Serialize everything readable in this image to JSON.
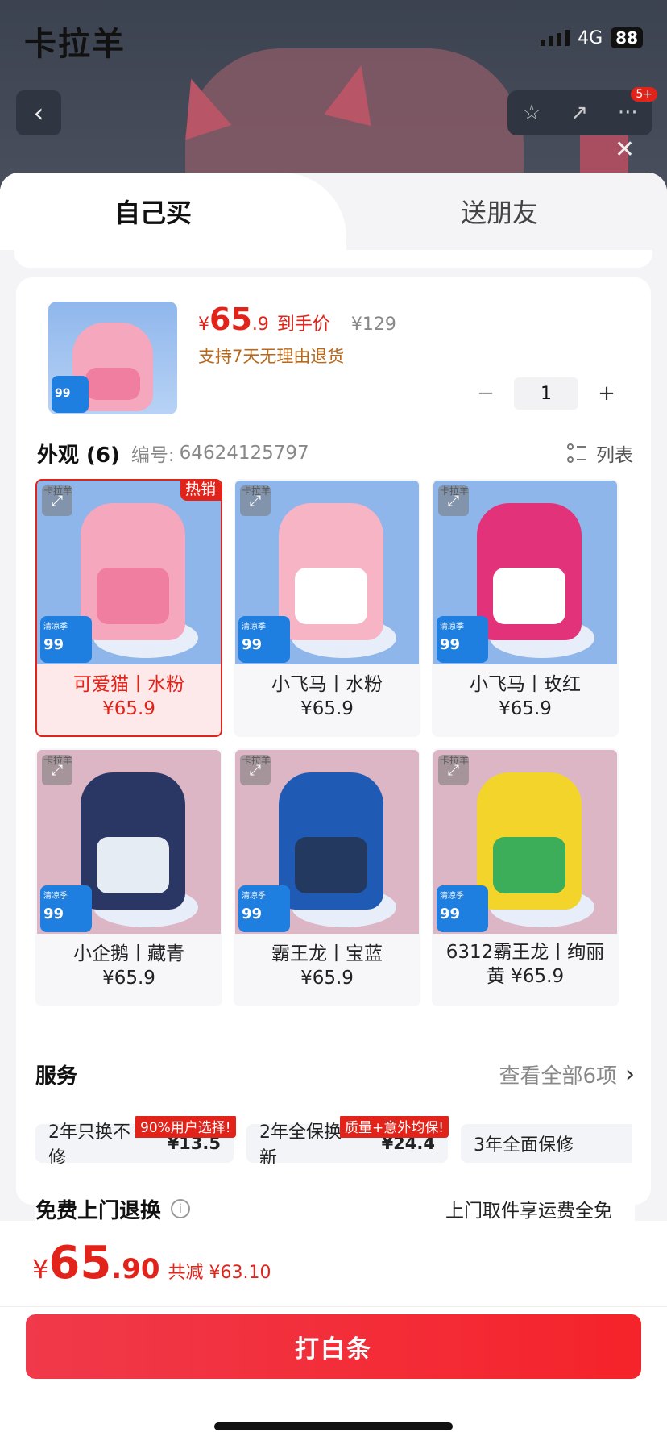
{
  "status_bar": {
    "brand": "卡拉羊",
    "network": "4G",
    "battery": "88"
  },
  "header": {
    "badge": "5+"
  },
  "tabs": [
    {
      "label": "自己买"
    },
    {
      "label": "送朋友"
    }
  ],
  "product": {
    "currency": "¥",
    "price_int": "65",
    "price_dec": ".9",
    "price_label": "到手价",
    "original_price": "¥129",
    "return_policy": "支持7天无理由退货",
    "quantity": "1",
    "thumb_promo": "99"
  },
  "appearance": {
    "title": "外观 (6)",
    "code_label": "编号:",
    "code_value": "64624125797",
    "list_label": "列表",
    "hot_badge": "热销",
    "brand_mini": "卡拉羊",
    "promo_label": "清凉季",
    "promo_price": "99",
    "variants": [
      {
        "name": "可爱猫丨水粉",
        "price": "¥65.9",
        "selected": true,
        "bg": "#8fb6ea",
        "bag": "#f5a8bd",
        "pocket": "#f07ea0"
      },
      {
        "name": "小飞马丨水粉",
        "price": "¥65.9",
        "selected": false,
        "bg": "#8fb6ea",
        "bag": "#f6b4c4",
        "pocket": "#fff"
      },
      {
        "name": "小飞马丨玫红",
        "price": "¥65.9",
        "selected": false,
        "bg": "#8fb6ea",
        "bag": "#e2327a",
        "pocket": "#fff"
      },
      {
        "name": "小企鹅丨藏青",
        "price": "¥65.9",
        "selected": false,
        "bg": "#dcb6c4",
        "bag": "#2a3764",
        "pocket": "#e6ecf4"
      },
      {
        "name": "霸王龙丨宝蓝",
        "price": "¥65.9",
        "selected": false,
        "bg": "#dcb6c4",
        "bag": "#1f5bb5",
        "pocket": "#23395f"
      },
      {
        "name": "6312霸王龙丨绚丽黄 ¥65.9",
        "price": "",
        "selected": false,
        "bg": "#dcb6c4",
        "bag": "#f2d42a",
        "pocket": "#3cae5a"
      }
    ]
  },
  "service": {
    "title": "服务",
    "view_all": "查看全部6项",
    "options": [
      {
        "badge": "90%用户选择!",
        "name": "2年只换不修",
        "price": "¥13.5"
      },
      {
        "badge": "质量+意外均保!",
        "name": "2年全保换新",
        "price": "¥24.4"
      },
      {
        "badge": "",
        "name": "3年全面保修",
        "price": ""
      }
    ]
  },
  "free_return": {
    "title": "免费上门退换",
    "desc": "上门取件享运费全免"
  },
  "bottom": {
    "currency": "¥",
    "total_int": "65",
    "total_dec": ".90",
    "saved": "共减 ¥63.10",
    "cta": "打白条"
  },
  "colors": {
    "accent": "#e2231a",
    "return_text": "#b8681a"
  }
}
